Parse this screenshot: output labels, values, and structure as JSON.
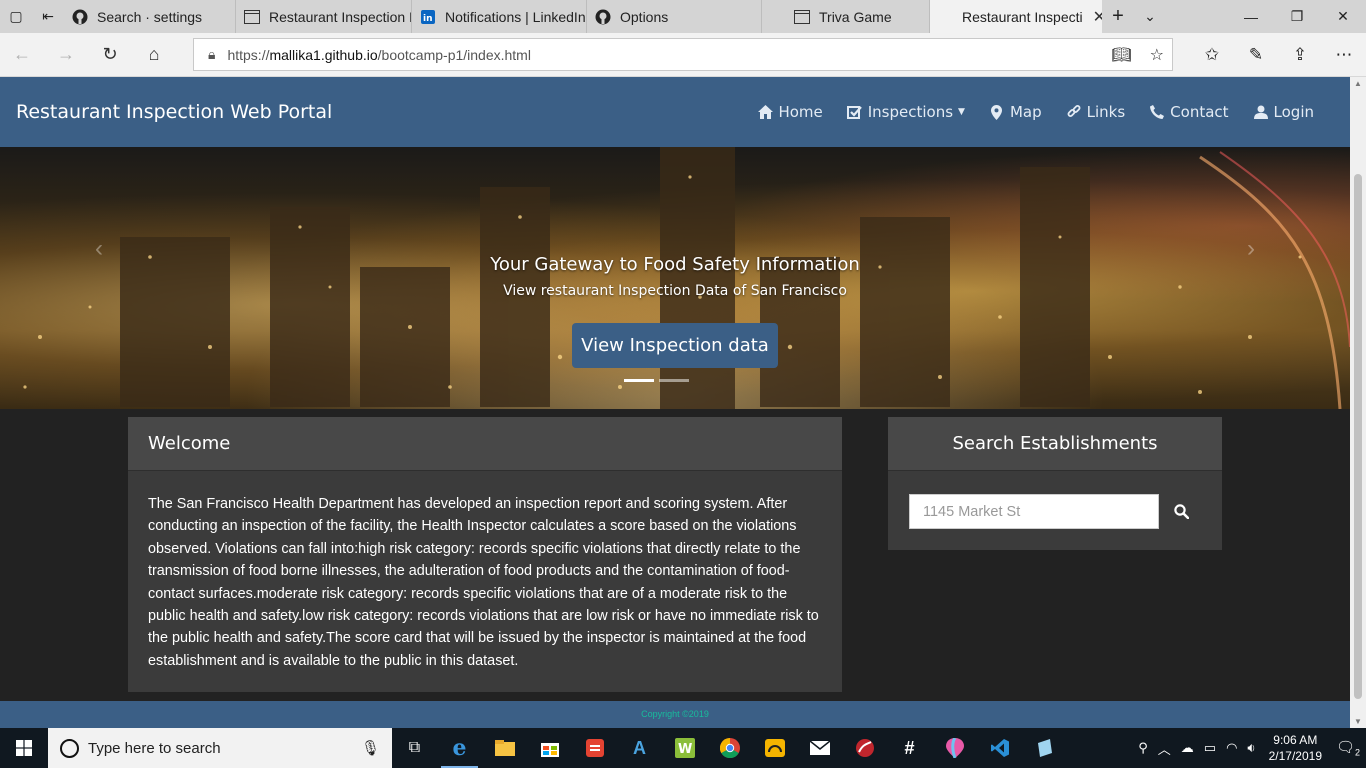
{
  "browser": {
    "tabs": [
      {
        "label": "Search · settings",
        "icon": "github-icon"
      },
      {
        "label": "Restaurant Inspection D",
        "icon": "page-icon"
      },
      {
        "label": "Notifications | LinkedIn",
        "icon": "linkedin-icon"
      },
      {
        "label": "Options",
        "icon": "github-icon"
      },
      {
        "label": "Triva Game",
        "icon": "page-icon"
      },
      {
        "label": "Restaurant Inspecti",
        "icon": "none",
        "active": true
      }
    ],
    "url_prefix": "https://",
    "url_domain": "mallika1.github.io",
    "url_path": "/bootcamp-p1/index.html"
  },
  "navbar": {
    "brand": "Restaurant Inspection Web Portal",
    "links": [
      {
        "label": "Home",
        "icon": "home-icon"
      },
      {
        "label": "Inspections",
        "icon": "checkbox-icon",
        "dropdown": true
      },
      {
        "label": "Map",
        "icon": "map-marker-icon"
      },
      {
        "label": "Links",
        "icon": "link-icon"
      },
      {
        "label": "Contact",
        "icon": "phone-icon"
      },
      {
        "label": "Login",
        "icon": "user-icon"
      }
    ]
  },
  "hero": {
    "title": "Your Gateway to Food Safety Information",
    "subtitle": "View restaurant Inspection Data of San Francisco",
    "button": "View Inspection data",
    "slides": 2,
    "active_slide": 1
  },
  "welcome": {
    "heading": "Welcome",
    "body": "The San Francisco Health Department has developed an inspection report and scoring system. After conducting an inspection of the facility, the Health Inspector calculates a score based on the violations observed. Violations can fall into:high risk category: records specific violations that directly relate to the transmission of food borne illnesses, the adulteration of food products and the contamination of food-contact surfaces.moderate risk category: records specific violations that are of a moderate risk to the public health and safety.low risk category: records violations that are low risk or have no immediate risk to the public health and safety.The score card that will be issued by the inspector is maintained at the food establishment and is available to the public in this dataset."
  },
  "search": {
    "heading": "Search Establishments",
    "placeholder": "1145 Market St"
  },
  "footer": {
    "copyright": "Copyright ©2019"
  },
  "taskbar": {
    "search_placeholder": "Type here to search",
    "time": "9:06 AM",
    "date": "2/17/2019",
    "notifications": "2"
  },
  "colors": {
    "navbar": "#3b5f86",
    "panel": "#3b3b3b",
    "panel_header": "#484848",
    "footer_text": "#18bc9c",
    "page_bg": "#222222"
  }
}
